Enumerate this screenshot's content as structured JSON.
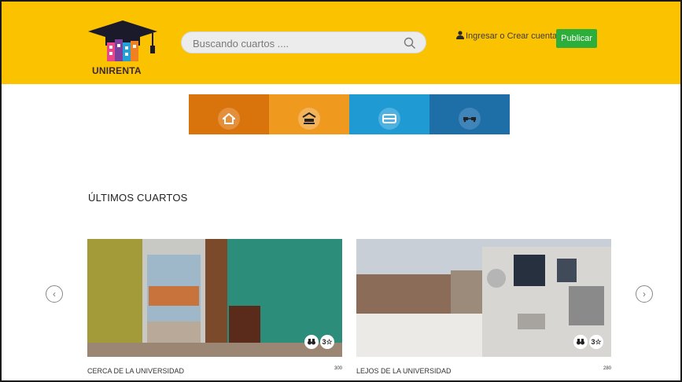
{
  "brand": {
    "name": "UNIRENTA"
  },
  "search": {
    "placeholder": "Buscando cuartos ...."
  },
  "header": {
    "login_label": "Ingresar o Crear cuenta",
    "publish_label": "Publicar"
  },
  "categories": [
    {
      "icon": "home-icon",
      "color": "#d9730c"
    },
    {
      "icon": "bed-room-icon",
      "color": "#ef9a1f"
    },
    {
      "icon": "bed-icon",
      "color": "#1f9ad3"
    },
    {
      "icon": "vehicles-icon",
      "color": "#1e6ea8"
    }
  ],
  "section": {
    "title": "ÚLTIMOS CUARTOS"
  },
  "listings": [
    {
      "title": "CERCA DE LA UNIVERSIDAD",
      "price": "300",
      "rating": "3"
    },
    {
      "title": "LEJOS DE LA UNIVERSIDAD",
      "price": "280",
      "rating": "3"
    }
  ],
  "carousel": {
    "prev": "‹",
    "next": "›"
  }
}
